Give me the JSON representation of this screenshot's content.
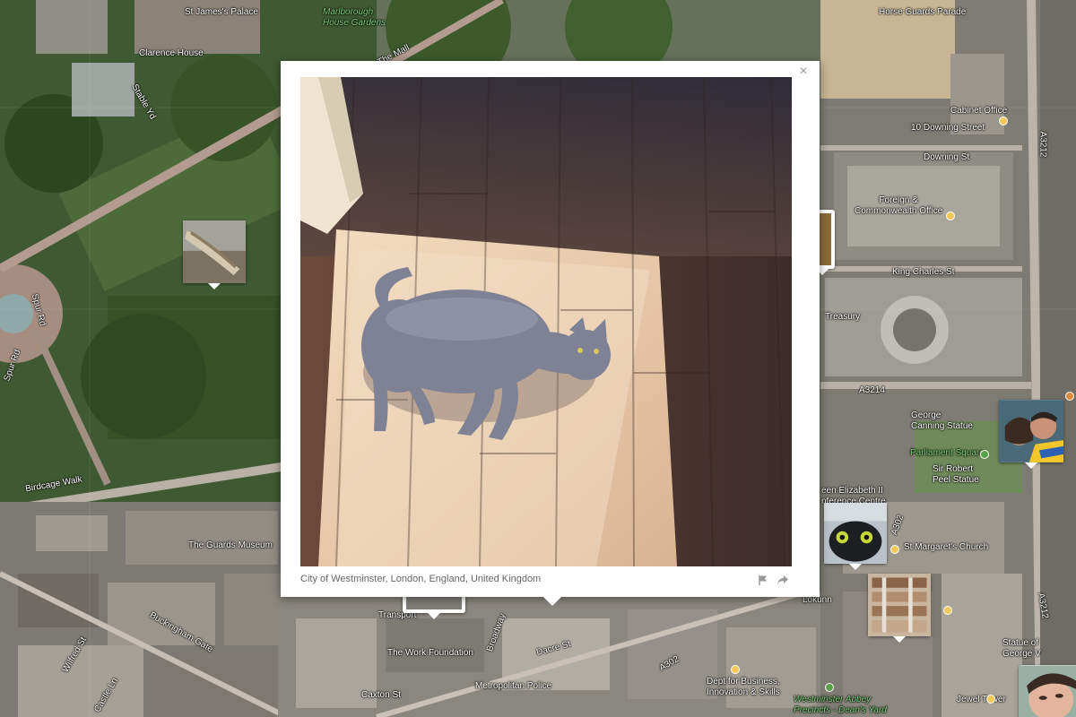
{
  "map": {
    "labels": [
      {
        "id": "st-james-palace",
        "text": "St James's Palace"
      },
      {
        "id": "marlborough",
        "text": "Marlborough\nHouse Gardens"
      },
      {
        "id": "clarence-house",
        "text": "Clarence House"
      },
      {
        "id": "the-mall",
        "text": "The Mall"
      },
      {
        "id": "stable-yd",
        "text": "Stable Yd"
      },
      {
        "id": "spur-rd-1",
        "text": "Spur Rd"
      },
      {
        "id": "spur-rd-2",
        "text": "Spur Rd"
      },
      {
        "id": "birdcage-walk",
        "text": "Birdcage Walk"
      },
      {
        "id": "guards-museum",
        "text": "The Guards Museum"
      },
      {
        "id": "buckingham-gate",
        "text": "Buckingham Gate"
      },
      {
        "id": "wilfred-st",
        "text": "Wilfred St"
      },
      {
        "id": "castle-ln",
        "text": "Castle Ln"
      },
      {
        "id": "caxton-st",
        "text": "Caxton St"
      },
      {
        "id": "work-foundation",
        "text": "The Work Foundation"
      },
      {
        "id": "metropolitan-police",
        "text": "Metropolitan Police"
      },
      {
        "id": "transport",
        "text": "Transport"
      },
      {
        "id": "broadway",
        "text": "Broadway"
      },
      {
        "id": "dacre-st",
        "text": "Dacre St"
      },
      {
        "id": "a302",
        "text": "A302"
      },
      {
        "id": "dept-business",
        "text": "Dept for Business,\nInnovation & Skills"
      },
      {
        "id": "westminster-abbey",
        "text": "Westminster Abbey\nPrecincts - Dean's Yard"
      },
      {
        "id": "jewel-tower",
        "text": "Jewel Tower"
      },
      {
        "id": "horse-guards",
        "text": "Horse Guards Parade"
      },
      {
        "id": "cabinet-office",
        "text": "Cabinet Office"
      },
      {
        "id": "downing-10",
        "text": "10 Downing Street"
      },
      {
        "id": "downing-st",
        "text": "Downing St"
      },
      {
        "id": "foreign-office",
        "text": "Foreign &\nCommonwealth Office"
      },
      {
        "id": "king-charles",
        "text": "King Charles St"
      },
      {
        "id": "treasury",
        "text": "Treasury"
      },
      {
        "id": "a3214",
        "text": "A3214"
      },
      {
        "id": "george-canning",
        "text": "George\nCanning Statue"
      },
      {
        "id": "parliament-square",
        "text": "Parliament Square"
      },
      {
        "id": "robert-peel",
        "text": "Sir Robert\nPeel Statue"
      },
      {
        "id": "elizabeth-ii",
        "text": "een Elizabeth II\nnference Centre"
      },
      {
        "id": "a302-b",
        "text": "A302"
      },
      {
        "id": "st-margarets",
        "text": "St Margaret's Church"
      },
      {
        "id": "a3212",
        "text": "A3212"
      },
      {
        "id": "a3212-b",
        "text": "A3212"
      },
      {
        "id": "statue-of",
        "text": "Statue of\nGeorge V"
      },
      {
        "id": "lokunn",
        "text": "Lokunn"
      }
    ]
  },
  "markers": [
    {
      "id": "marker-lizard",
      "label": "lizard photo"
    },
    {
      "id": "marker-selfie",
      "label": "couple selfie photo"
    },
    {
      "id": "marker-black-cat",
      "label": "black cat photo"
    },
    {
      "id": "marker-shelf",
      "label": "shelf photo"
    },
    {
      "id": "marker-face",
      "label": "face photo"
    }
  ],
  "popup": {
    "caption": "City of Westminster, London, England, United Kingdom",
    "close_glyph": "×"
  },
  "colors": {
    "popup_bg": "#ffffff",
    "caption": "#666666",
    "icon_gray": "#9a9a9a"
  },
  "icons": {
    "close": "close-icon",
    "flag": "flag-icon",
    "share": "share-arrow-icon"
  }
}
